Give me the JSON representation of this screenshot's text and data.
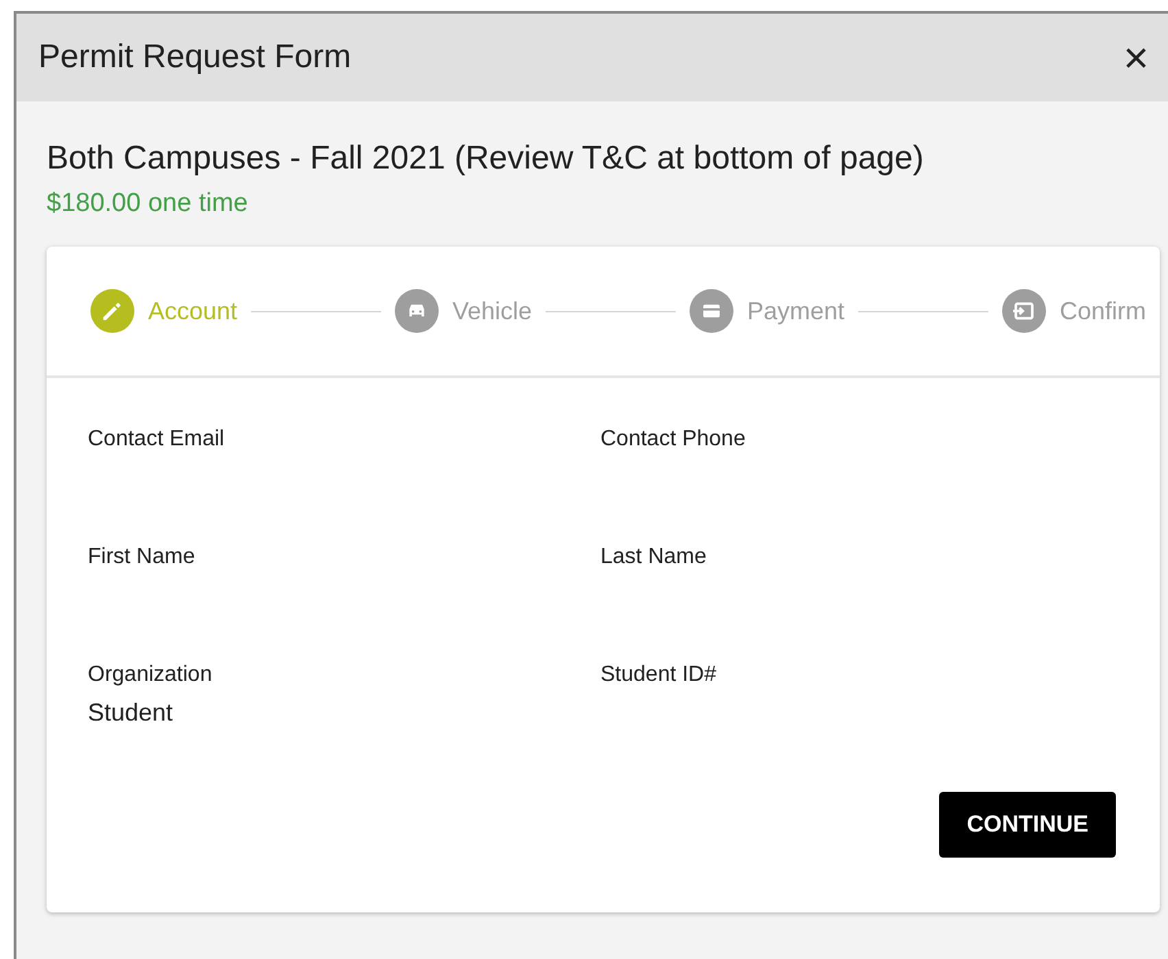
{
  "window": {
    "title": "Permit Request Form",
    "close": "×"
  },
  "permit": {
    "title": "Both Campuses - Fall 2021 (Review T&C at bottom of page)",
    "price": "$180.00 one time"
  },
  "steps": [
    {
      "label": "Account",
      "kind": "edit",
      "selected": true
    },
    {
      "label": "Vehicle",
      "kind": "car",
      "selected": false
    },
    {
      "label": "Payment",
      "kind": "card",
      "selected": false
    },
    {
      "label": "Confirm",
      "kind": "enter",
      "selected": false
    }
  ],
  "fields": [
    {
      "label": "Contact Email"
    },
    {
      "label": "Contact Phone"
    },
    {
      "label": "First Name"
    },
    {
      "label": "Last Name"
    },
    {
      "label": "Organization",
      "value": "Student"
    },
    {
      "label": "Student ID#"
    }
  ],
  "buttons": [
    "CONTINUE"
  ]
}
